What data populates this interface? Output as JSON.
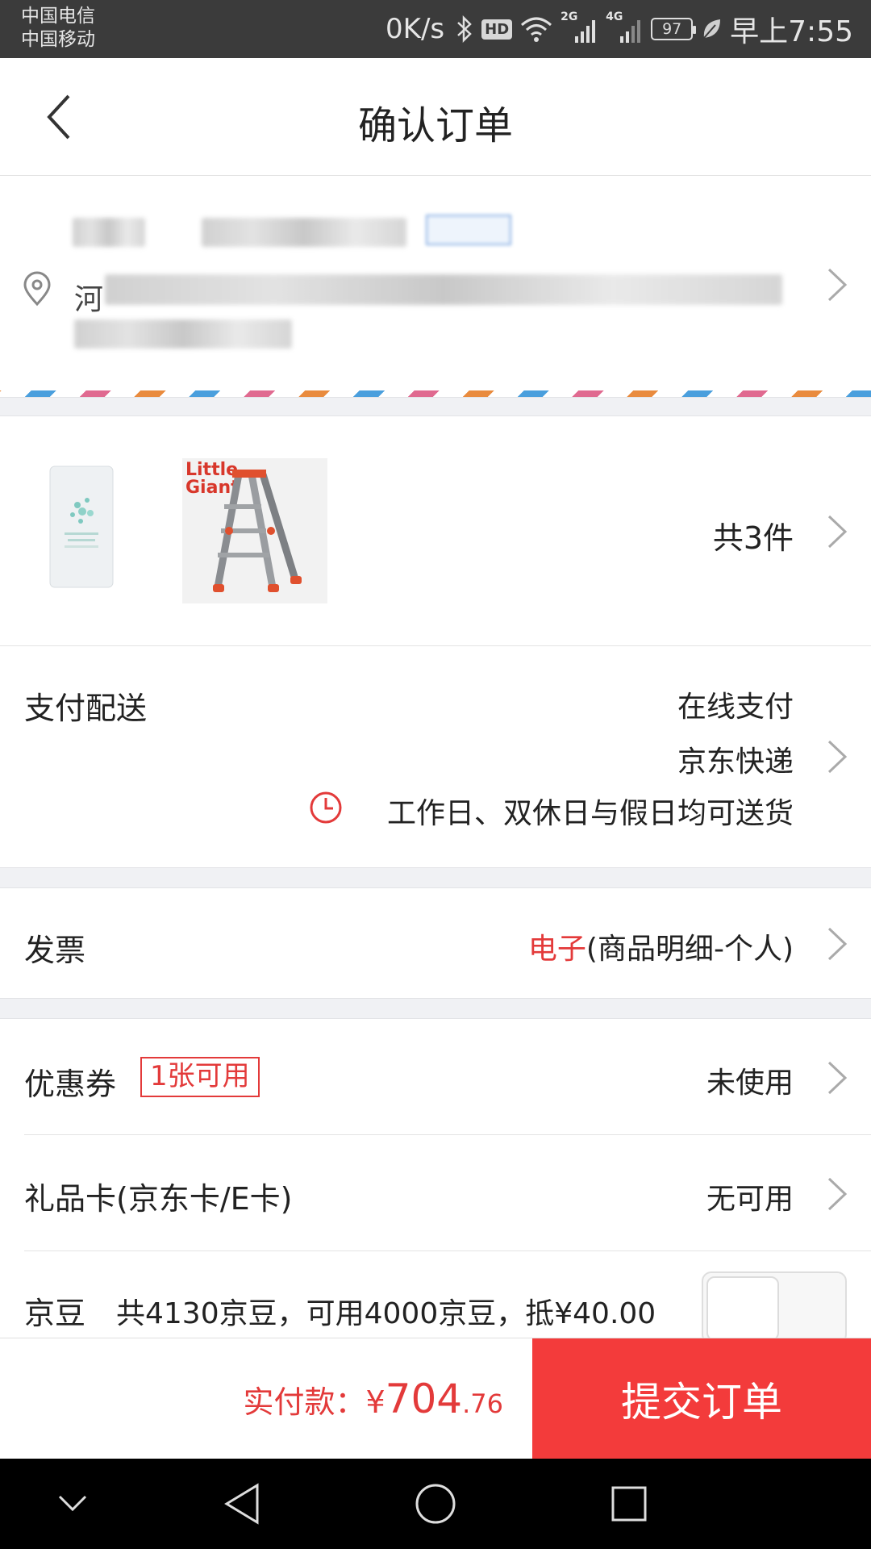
{
  "status_bar": {
    "carrier1": "中国电信",
    "carrier2": "中国移动",
    "net_speed": "0K/s",
    "hd": "HD",
    "sig1_type": "2G",
    "sig2_type": "4G",
    "battery": "97",
    "time": "早上7:55"
  },
  "header": {
    "title": "确认订单"
  },
  "address": {
    "visible_prefix": "河"
  },
  "products": {
    "count_label": "共3件",
    "thumb2_brand": "Little Giant"
  },
  "payment": {
    "label": "支付配送",
    "method": "在线支付",
    "courier": "京东快递",
    "delivery_note": "工作日、双休日与假日均可送货"
  },
  "invoice": {
    "label": "发票",
    "type": "电子",
    "detail": "(商品明细-个人)"
  },
  "coupon": {
    "label": "优惠券",
    "badge": "1张可用",
    "value": "未使用"
  },
  "giftcard": {
    "label": "礼品卡(京东卡/E卡)",
    "value": "无可用"
  },
  "jingdou": {
    "label": "京豆",
    "detail": "共4130京豆，可用4000京豆，抵¥40.00"
  },
  "footer": {
    "total_label": "实付款：",
    "currency": "¥",
    "amount_int": "704",
    "amount_dec": ".76",
    "submit_label": "提交订单"
  },
  "colors": {
    "accent_red": "#f33b3b",
    "text_red": "#e33a3a"
  }
}
